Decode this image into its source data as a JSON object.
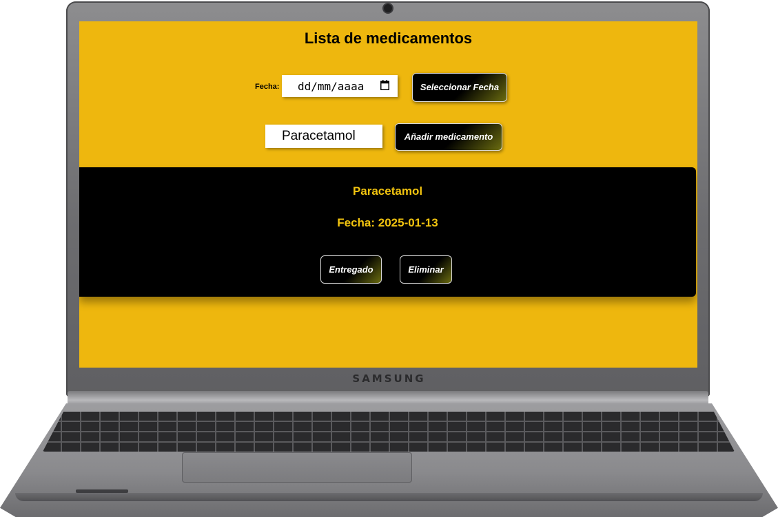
{
  "device": {
    "brand": "SAMSUNG"
  },
  "app": {
    "title": "Lista de medicamentos",
    "date_label": "Fecha:",
    "date_placeholder": "dd/mm/aaaa",
    "select_date_button": "Seleccionar Fecha",
    "medication_input_value": "Paracetamol",
    "add_button": "Añadir medicamento",
    "background_color": "#eeb70e",
    "card": {
      "name": "Paracetamol",
      "date_text": "Fecha: 2025-01-13",
      "delivered_button": "Entregado",
      "delete_button": "Eliminar",
      "text_color": "#f2c40f"
    },
    "icons": {
      "date_picker": "calendar-icon"
    }
  }
}
